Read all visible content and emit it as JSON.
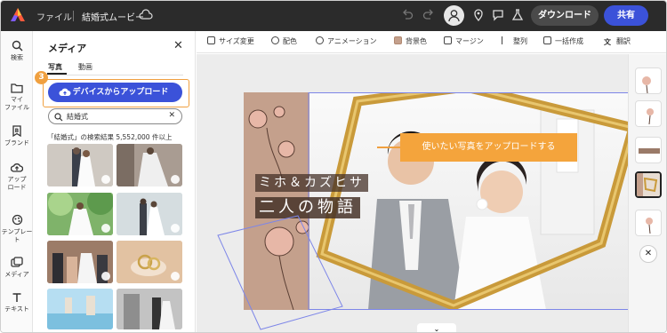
{
  "topbar": {
    "file_label": "ファイル",
    "project_title": "結婚式ムービー",
    "download_label": "ダウンロード",
    "share_label": "共有"
  },
  "rail": {
    "items": [
      {
        "label": "検索",
        "icon": "search-icon"
      },
      {
        "label": "マイ\nファイル",
        "icon": "folder-icon"
      },
      {
        "label": "ブランド",
        "icon": "brand-icon"
      },
      {
        "label": "アップ\nロード",
        "icon": "upload-icon"
      },
      {
        "label": "テンプレート",
        "icon": "template-icon"
      },
      {
        "label": "メディア",
        "icon": "media-icon"
      },
      {
        "label": "テキスト",
        "icon": "text-icon"
      }
    ]
  },
  "panel": {
    "title": "メディア",
    "tabs": [
      "写真",
      "動画"
    ],
    "upload_button": "デバイスからアップロード",
    "step_number": "3",
    "search_query": "結婚式",
    "result_text": "「結婚式」の検索結果 5,552,000 件以上"
  },
  "toolbar": {
    "items": [
      "サイズ変更",
      "配色",
      "アニメーション",
      "背景色",
      "マージン",
      "整列",
      "一括作成",
      "翻訳"
    ]
  },
  "canvas": {
    "tooltip": "使いたい写真をアップロードする",
    "design_names": "ミホ＆カズヒサ",
    "design_subtitle": "二人の物語"
  },
  "colors": {
    "accent_blue": "#3b52d9",
    "callout_orange": "#f4a43c",
    "design_panel": "#c4a08c"
  }
}
